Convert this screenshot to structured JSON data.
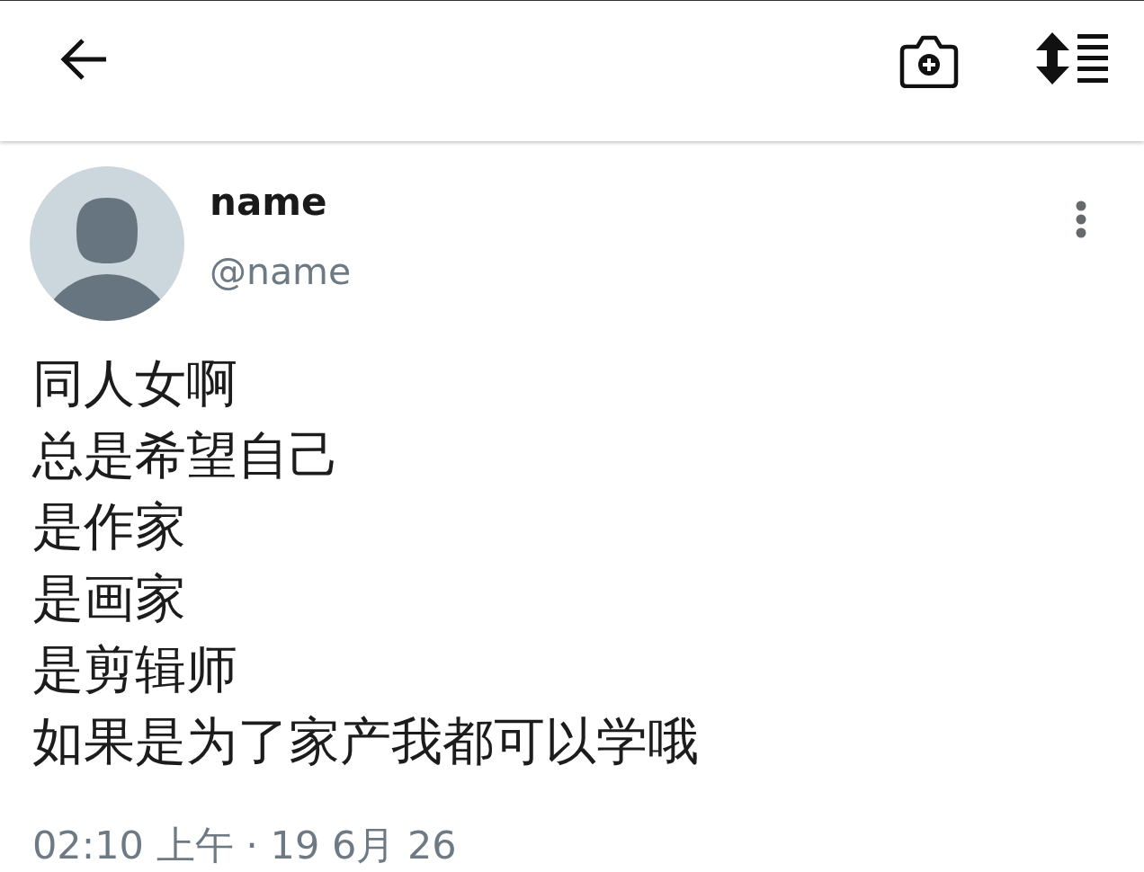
{
  "post": {
    "author": {
      "name": "name",
      "handle": "@name"
    },
    "text_lines": [
      "同人女啊",
      "总是希望自己",
      "是作家",
      "是画家",
      "是剪辑师",
      "如果是为了家产我都可以学哦"
    ],
    "timestamp": "02:10 上午 · 19 6月 26"
  }
}
